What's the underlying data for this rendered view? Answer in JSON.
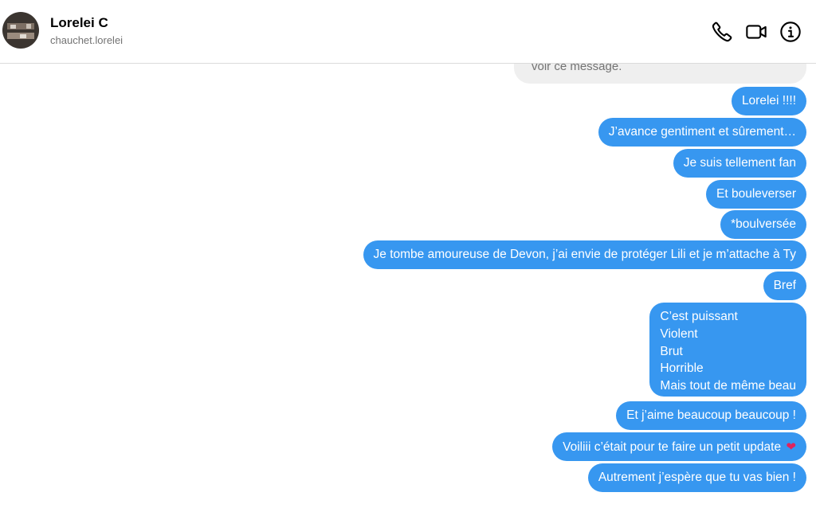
{
  "contact": {
    "name": "Lorelei C",
    "handle": "chauchet.lorelei"
  },
  "header_icons": [
    "phone-icon",
    "video-camera-icon",
    "info-icon"
  ],
  "colors": {
    "outgoing_bubble": "#3797f0",
    "incoming_bubble": "#efefef",
    "heart": "#e0245e"
  },
  "incoming_partial": {
    "text": "voir ce message."
  },
  "messages": [
    {
      "text": "Lorelei !!!!"
    },
    {
      "text": "J’avance gentiment et sûrement…"
    },
    {
      "text": "Je suis tellement fan"
    },
    {
      "text": "Et bouleverser"
    },
    {
      "text": "*boulversée"
    },
    {
      "text": "Je tombe amoureuse de Devon, j’ai envie de protéger Lili et je m’attache à Ty"
    },
    {
      "text": "Bref"
    },
    {
      "text": "C’est puissant\nViolent\nBrut\nHorrible\nMais tout de même beau"
    },
    {
      "text": "Et j’aime beaucoup beaucoup !"
    },
    {
      "text": "Voiliii c’était pour te faire un petit update",
      "emoji": "❤"
    },
    {
      "text": "Autrement j’espère que tu vas bien !"
    }
  ]
}
